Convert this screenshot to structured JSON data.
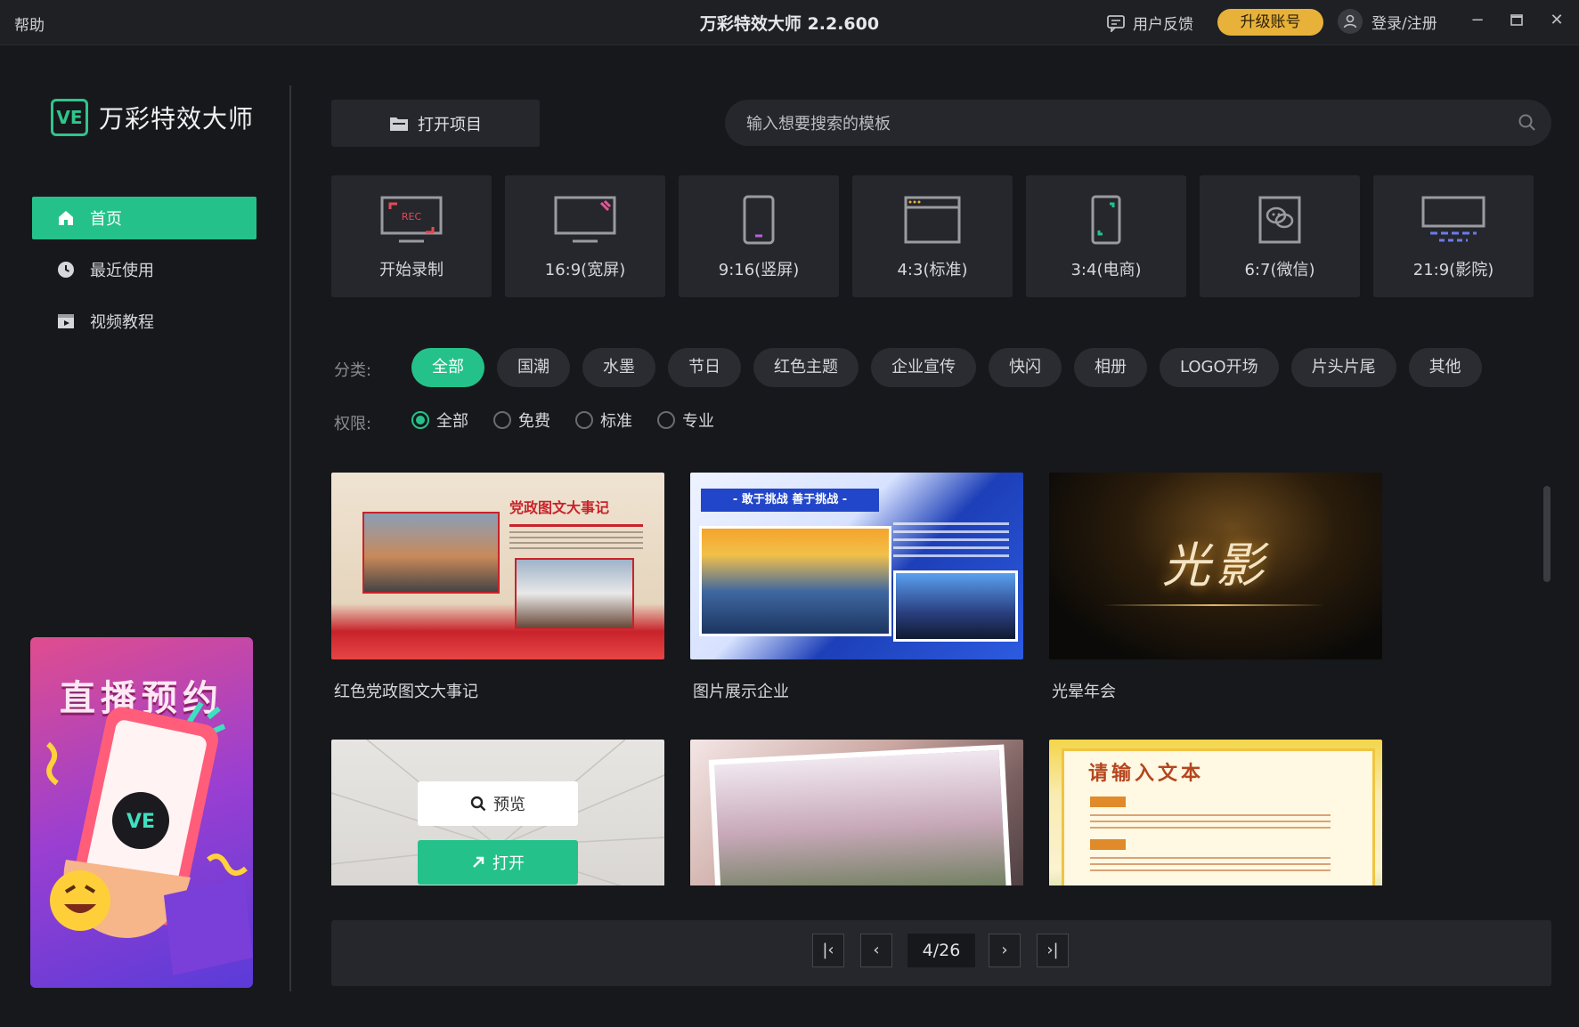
{
  "titlebar": {
    "help": "帮助",
    "title": "万彩特效大师 2.2.600",
    "feedback": "用户反馈",
    "upgrade": "升级账号",
    "login": "登录/注册",
    "icons": [
      "minimize-icon",
      "maximize-icon",
      "close-icon"
    ]
  },
  "brand": {
    "logo_mark": "VE",
    "name": "万彩特效大师",
    "accent": "#24c28a"
  },
  "nav": [
    {
      "label": "首页",
      "icon": "home-icon",
      "active": true
    },
    {
      "label": "最近使用",
      "icon": "clock-icon",
      "active": false
    },
    {
      "label": "视频教程",
      "icon": "video-tutorial-icon",
      "active": false
    }
  ],
  "promo": {
    "title": "直播预约",
    "badge": "VE"
  },
  "toolbar": {
    "open_project": "打开项目",
    "search_placeholder": "输入想要搜索的模板"
  },
  "canvas_sizes": [
    {
      "label": "开始录制",
      "icon": "record-screen-icon",
      "rec": "REC"
    },
    {
      "label": "16:9(宽屏)",
      "icon": "widescreen-icon"
    },
    {
      "label": "9:16(竖屏)",
      "icon": "portrait-icon"
    },
    {
      "label": "4:3(标准)",
      "icon": "standard-icon"
    },
    {
      "label": "3:4(电商)",
      "icon": "ecommerce-icon"
    },
    {
      "label": "6:7(微信)",
      "icon": "wechat-icon"
    },
    {
      "label": "21:9(影院)",
      "icon": "cinema-icon"
    }
  ],
  "filters": {
    "category_label": "分类:",
    "categories": [
      "全部",
      "国潮",
      "水墨",
      "节日",
      "红色主题",
      "企业宣传",
      "快闪",
      "相册",
      "LOGO开场",
      "片头片尾",
      "其他"
    ],
    "active_category": 0,
    "permission_label": "权限:",
    "permissions": [
      "全部",
      "免费",
      "标准",
      "专业"
    ],
    "active_permission": 0
  },
  "templates": [
    {
      "name": "红色党政图文大事记",
      "thumb_text": "党政图文大事记"
    },
    {
      "name": "图片展示企业",
      "thumb_text": "- 敢于挑战 善于挑战 -"
    },
    {
      "name": "光晕年会",
      "thumb_text": "光影"
    },
    {
      "name": "",
      "thumb_text": ""
    },
    {
      "name": "",
      "thumb_text": ""
    },
    {
      "name": "",
      "thumb_text": "请输入文本"
    }
  ],
  "hover": {
    "preview": "预览",
    "open": "打开"
  },
  "pagination": {
    "current": 4,
    "total": 26,
    "display": "4/26"
  }
}
